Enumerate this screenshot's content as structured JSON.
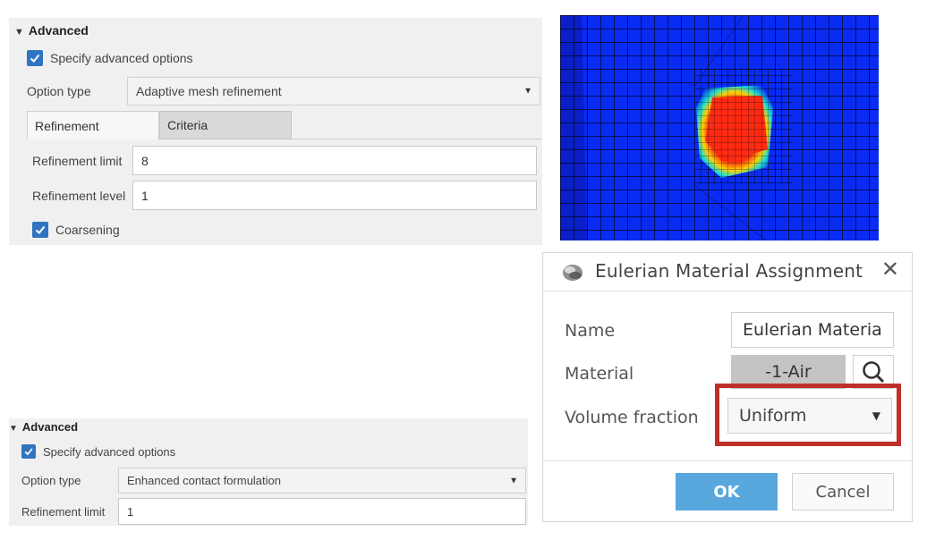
{
  "panel_top": {
    "section_title": "Advanced",
    "specify_checkbox": {
      "label": "Specify advanced options",
      "checked": true
    },
    "option_type": {
      "label": "Option type",
      "value": "Adaptive mesh refinement"
    },
    "tabs": [
      {
        "label": "Refinement",
        "active": true
      },
      {
        "label": "Criteria",
        "active": false
      }
    ],
    "refinement_limit": {
      "label": "Refinement limit",
      "value": "8"
    },
    "refinement_level": {
      "label": "Refinement level",
      "value": "1"
    },
    "coarsening_checkbox": {
      "label": "Coarsening",
      "checked": true
    }
  },
  "panel_bottom": {
    "section_title": "Advanced",
    "specify_checkbox": {
      "label": "Specify advanced options",
      "checked": true
    },
    "option_type": {
      "label": "Option type",
      "value": "Enhanced contact formulation"
    },
    "refinement_limit": {
      "label": "Refinement limit",
      "value": "1"
    }
  },
  "dialog": {
    "title": "Eulerian Material Assignment",
    "close": "✕",
    "name": {
      "label": "Name",
      "value": "Eulerian Materia"
    },
    "material": {
      "label": "Material",
      "value": "-1-Air"
    },
    "volume_fraction": {
      "label": "Volume fraction",
      "value": "Uniform"
    },
    "ok_label": "OK",
    "cancel_label": "Cancel"
  },
  "colors": {
    "accent": "#2f74c0",
    "ok_button": "#58a7dd",
    "highlight_box": "#c0302a",
    "mesh_blue": "#0a2bf2"
  }
}
